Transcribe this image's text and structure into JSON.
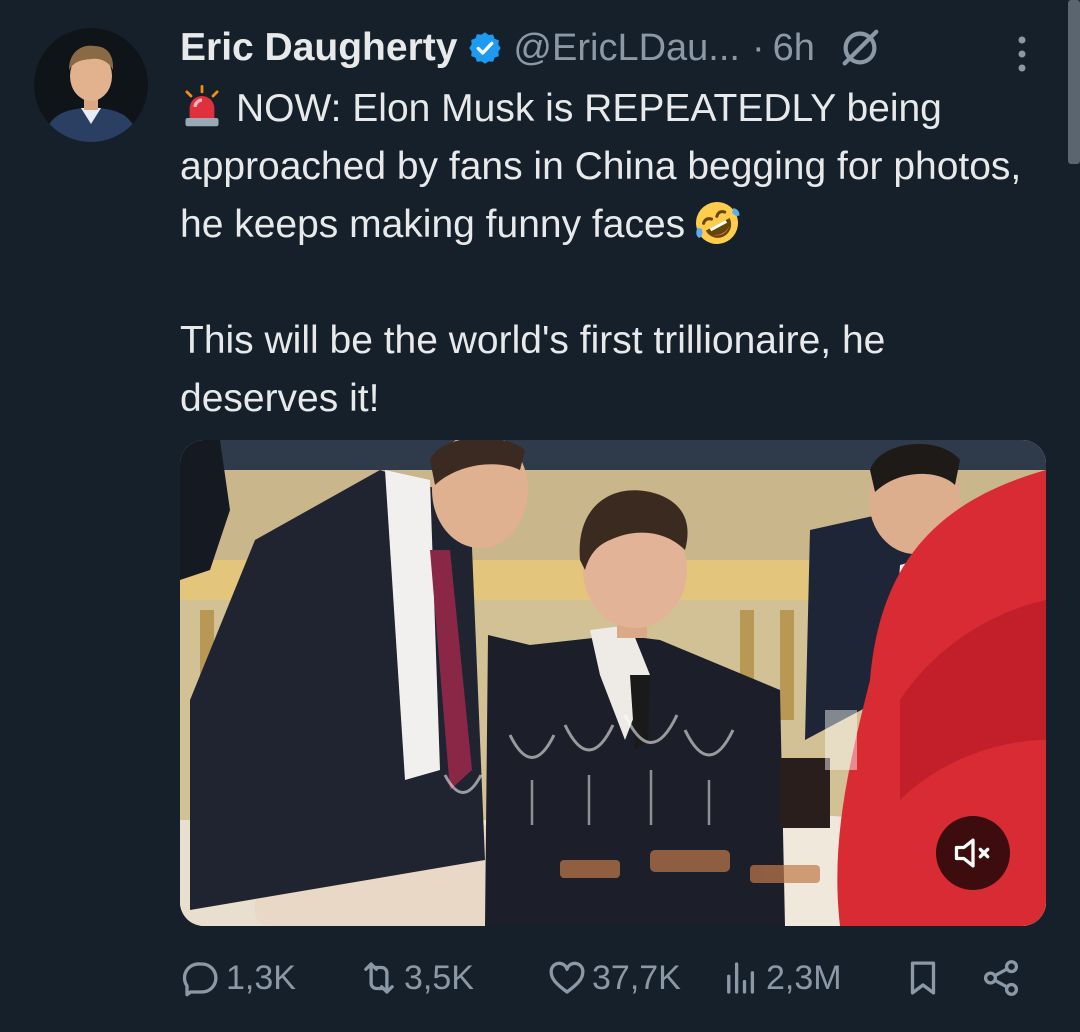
{
  "author": {
    "name": "Eric Daugherty",
    "handle": "@EricLDau...",
    "separator": "·",
    "time": "6h",
    "verified": true,
    "avatar": "avatar-icon"
  },
  "tweet": {
    "paragraph1": "NOW: Elon Musk is REPEATEDLY being approached by fans in China begging for photos, he keeps making funny faces",
    "paragraph2": "This will be the world's first trillionaire, he deserves it!",
    "emoji_start": "police-light-icon",
    "emoji_end": "rofl-icon"
  },
  "media": {
    "type": "video",
    "muted": true,
    "mute_icon": "volume-mute-icon"
  },
  "actions": {
    "replies": "1,3K",
    "reposts": "3,5K",
    "likes": "37,7K",
    "views": "2,3M"
  },
  "colors": {
    "background": "#15202b",
    "text": "#e7e9ea",
    "muted": "#8b98a5",
    "verified": "#1d9bf0"
  }
}
